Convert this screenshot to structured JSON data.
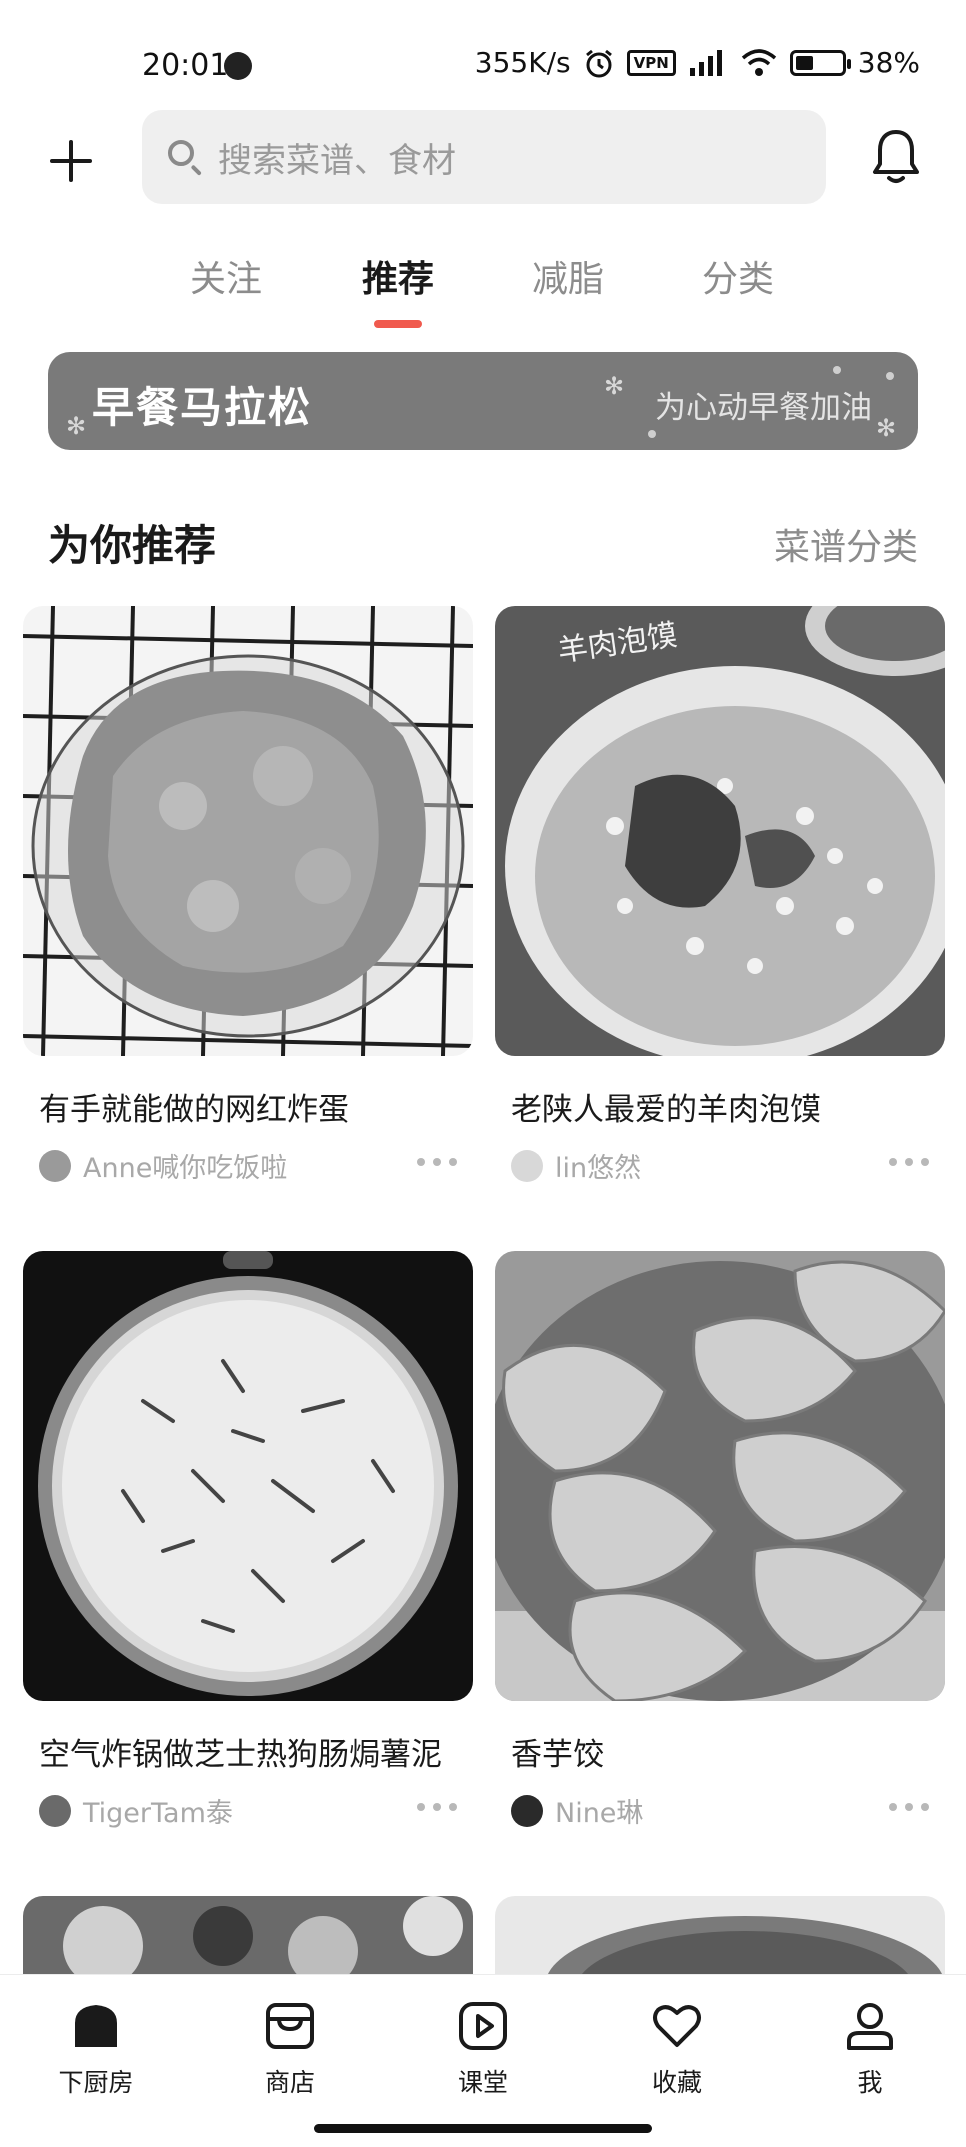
{
  "status_bar": {
    "time": "20:01",
    "network_speed": "355K/s",
    "vpn": "VPN",
    "battery": "38%",
    "battery_level": 0.38
  },
  "header": {
    "add_icon": "plus-icon",
    "search_placeholder": "搜索菜谱、食材",
    "bell_icon": "bell-icon"
  },
  "tabs": [
    {
      "label": "关注",
      "active": false
    },
    {
      "label": "推荐",
      "active": true
    },
    {
      "label": "减脂",
      "active": false
    },
    {
      "label": "分类",
      "active": false
    }
  ],
  "banner": {
    "title": "早餐马拉松",
    "subtitle": "为心动早餐加油"
  },
  "section": {
    "title": "为你推荐",
    "link": "菜谱分类"
  },
  "recipes": [
    {
      "title": "有手就能做的网红炸蛋",
      "author": "Anne喊你吃饭啦"
    },
    {
      "title": "老陕人最爱的羊肉泡馍",
      "author": "lin悠然",
      "image_caption": "羊肉泡馍"
    },
    {
      "title": "空气炸锅做芝士热狗肠焗薯泥",
      "author": "TigerTam泰"
    },
    {
      "title": "香芋饺",
      "author": "Nine琳"
    }
  ],
  "bottom_nav": [
    {
      "label": "下厨房",
      "icon": "home-icon",
      "active": true
    },
    {
      "label": "商店",
      "icon": "shop-icon",
      "active": false
    },
    {
      "label": "课堂",
      "icon": "play-icon",
      "active": false
    },
    {
      "label": "收藏",
      "icon": "heart-icon",
      "active": false
    },
    {
      "label": "我",
      "icon": "user-icon",
      "active": false
    }
  ],
  "colors": {
    "accent": "#f05a4e",
    "banner_bg": "#7a7a7a",
    "search_bg": "#efefef",
    "muted_text": "#8c8c8c"
  }
}
